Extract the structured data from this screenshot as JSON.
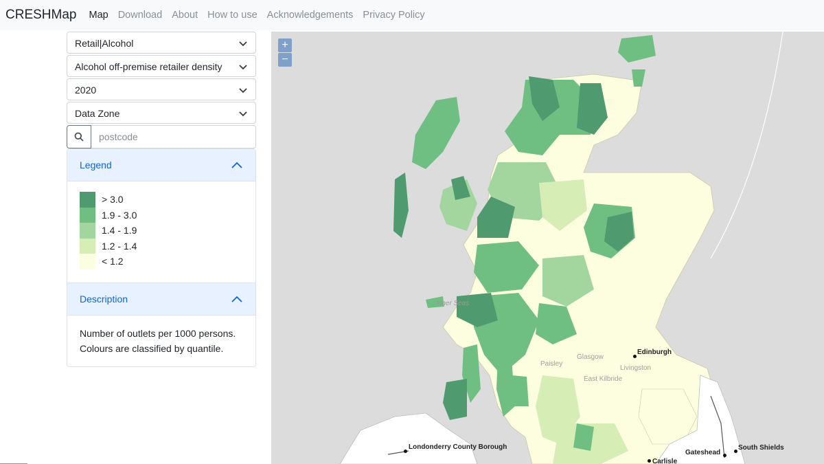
{
  "navbar": {
    "brand": "CRESHMap",
    "links": [
      "Map",
      "Download",
      "About",
      "How to use",
      "Acknowledgements",
      "Privacy Policy"
    ]
  },
  "controls": {
    "category": "Retail|Alcohol",
    "measure": "Alcohol off-premise retailer density",
    "year": "2020",
    "geography": "Data Zone",
    "search_placeholder": "postcode"
  },
  "legend": {
    "title": "Legend",
    "items": [
      {
        "label": "> 3.0",
        "color": "#4f9a6e"
      },
      {
        "label": "1.9 - 3.0",
        "color": "#6fbf82"
      },
      {
        "label": "1.4 - 1.9",
        "color": "#a3d69f"
      },
      {
        "label": "1.2 - 1.4",
        "color": "#d6eeb6"
      },
      {
        "label": "< 1.2",
        "color": "#fdfde0"
      }
    ]
  },
  "description": {
    "title": "Description",
    "line1": "Number of outlets per 1000 persons.",
    "line2": "Colours are classified by quantile."
  },
  "map": {
    "zoom_in": "+",
    "zoom_out": "−",
    "labels": {
      "inner_seas": "Inner Seas",
      "glasgow": "Glasgow",
      "paisley": "Paisley",
      "livingston": "Livingston",
      "east_kilbride": "East Kilbride",
      "edinburgh": "Edinburgh",
      "londonderry": "Londonderry County Borough",
      "gateshead": "Gateshead",
      "south_shields": "South Shields",
      "carlisle": "Carlisle"
    }
  }
}
